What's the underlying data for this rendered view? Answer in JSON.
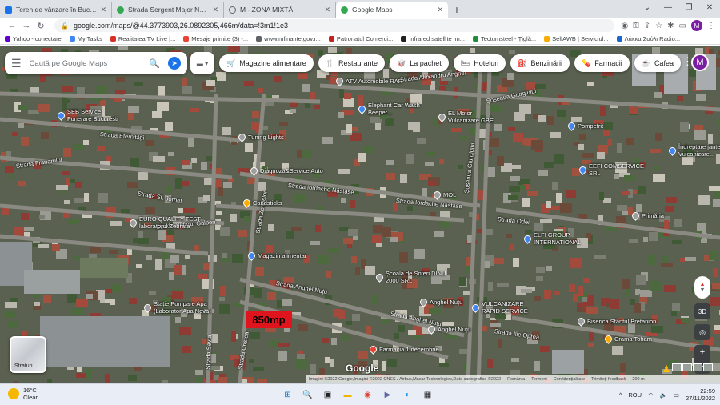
{
  "browser": {
    "tabs": [
      {
        "title": "Teren de vânzare în Bucuresti Gi...",
        "color": "#1a73e8"
      },
      {
        "title": "Strada Sergent Major Nedeleanu...",
        "color": "#34a853"
      },
      {
        "title": "M - ZONA MIXTĂ",
        "color": "#5f6368"
      },
      {
        "title": "Google Maps",
        "color": "#34a853",
        "active": true
      }
    ],
    "new_tab": "+",
    "url": "google.com/maps/@44.3773903,26.0892305,466m/data=!3m1!1e3",
    "profile_initial": "M",
    "bookmarks": [
      {
        "label": "Yahoo - conectare",
        "color": "#6001d2"
      },
      {
        "label": "My Tasks",
        "color": "#4285f4"
      },
      {
        "label": "Realitatea TV Live |...",
        "color": "#d93025"
      },
      {
        "label": "Mesaje primite (3) -...",
        "color": "#ea4335"
      },
      {
        "label": "www.mfinante.gov.r...",
        "color": "#5f6368"
      },
      {
        "label": "Patronatul Comerci...",
        "color": "#c5221f"
      },
      {
        "label": "Infrared satellite im...",
        "color": "#202124"
      },
      {
        "label": "Tectumsteel - Țiglă...",
        "color": "#1e8e3e"
      },
      {
        "label": "SelfAWB | Serviciul...",
        "color": "#f9ab00"
      },
      {
        "label": "Λάκκα Σούλι Radio...",
        "color": "#1967d2"
      }
    ]
  },
  "maps": {
    "search_placeholder": "Caută pe Google Maps",
    "chips": [
      {
        "label": "Magazine alimentare",
        "icon": "cart-icon"
      },
      {
        "label": "Restaurante",
        "icon": "fork-knife-icon"
      },
      {
        "label": "La pachet",
        "icon": "takeout-icon"
      },
      {
        "label": "Hoteluri",
        "icon": "bed-icon"
      },
      {
        "label": "Benzinării",
        "icon": "fuel-icon"
      },
      {
        "label": "Farmacii",
        "icon": "pharmacy-icon"
      },
      {
        "label": "Cafea",
        "icon": "coffee-icon"
      }
    ],
    "avatar_initial": "M",
    "layers_label": "Straturi",
    "area_label": "850mp",
    "logo": "Google",
    "attribution": [
      "Imagini ©2022 Google,Imagini ©2022 CNES / Airbus,Maxar Technologies,Date cartografice ©2022",
      "România",
      "Termeni",
      "Confidențialitate",
      "Trimiteți feedback",
      "200 m"
    ],
    "btn_3d": "3D",
    "streets": [
      {
        "text": "Strada Alexandru Anghel"
      },
      {
        "text": "Strada Eternității"
      },
      {
        "text": "Strada Franarului"
      },
      {
        "text": "Strada Sf. Jornet"
      },
      {
        "text": "Strada Nufarul Galben"
      },
      {
        "text": "Strada Iordache Năstase"
      },
      {
        "text": "Strada Iordache Năstase"
      },
      {
        "text": "Strada Anghel Nuțu"
      },
      {
        "text": "Strada Anghel Nuțu"
      },
      {
        "text": "Șoseaua Giurgiului"
      },
      {
        "text": "Strada Odei"
      },
      {
        "text": "Strada Ilie Oprea"
      },
      {
        "text": "Strada Cristea"
      },
      {
        "text": "Strada Savia"
      },
      {
        "text": "Strada Zorelelor"
      },
      {
        "text": "Șoseaua Giurgiului"
      }
    ],
    "pois": [
      {
        "text": "SEB Service Funerare Bucuresti",
        "color": "#4285f4"
      },
      {
        "text": "Tuning Lights",
        "color": "#5f6368"
      },
      {
        "text": "Diagnoza&Service Auto",
        "color": "#5f6368"
      },
      {
        "text": "Candsticks",
        "color": "#f9ab00"
      },
      {
        "text": "Magazin alimentar",
        "color": "#4285f4"
      },
      {
        "text": "EURO QUALITY TEST laboratorul Zebrafa",
        "color": "#5f6368"
      },
      {
        "text": "Elephant Car Wash Beeper...",
        "color": "#4285f4"
      },
      {
        "text": "MOL",
        "color": "#5f6368"
      },
      {
        "text": "Școala de Șoferi DINU 2000 SRL",
        "color": "#5f6368"
      },
      {
        "text": "Anghel Nuțu",
        "color": "#5f6368"
      },
      {
        "text": "Anghel Nuțu",
        "color": "#5f6368"
      },
      {
        "text": "VULCANIZARE RAPID SERVICE",
        "color": "#4285f4"
      },
      {
        "text": "Farmacia 1 decembrie",
        "color": "#ea4335"
      },
      {
        "text": "ELFI GROUP INTERNATIONAL",
        "color": "#4285f4"
      },
      {
        "text": "EEFI COMSERVICE SRL",
        "color": "#4285f4"
      },
      {
        "text": "Primăria",
        "color": "#5f6368"
      },
      {
        "text": "Pompefrit",
        "color": "#4285f4"
      },
      {
        "text": "Îndreptare jante Vulcanizare...",
        "color": "#4285f4"
      },
      {
        "text": "Stație Pompare Apa (Laborator Apa Nova)",
        "color": "#5f6368"
      },
      {
        "text": "Biserica Sfântul Bretanion",
        "color": "#5f6368"
      },
      {
        "text": "Crama Toham",
        "color": "#f9ab00"
      },
      {
        "text": "ATV Automobile RAR",
        "color": "#5f6368"
      },
      {
        "text": "EL Motor Vulcanizare GBE",
        "color": "#5f6368"
      }
    ]
  },
  "taskbar": {
    "temperature": "16°C",
    "condition": "Clear",
    "language": "ROU",
    "time": "22:59",
    "date": "27/11/2022"
  }
}
